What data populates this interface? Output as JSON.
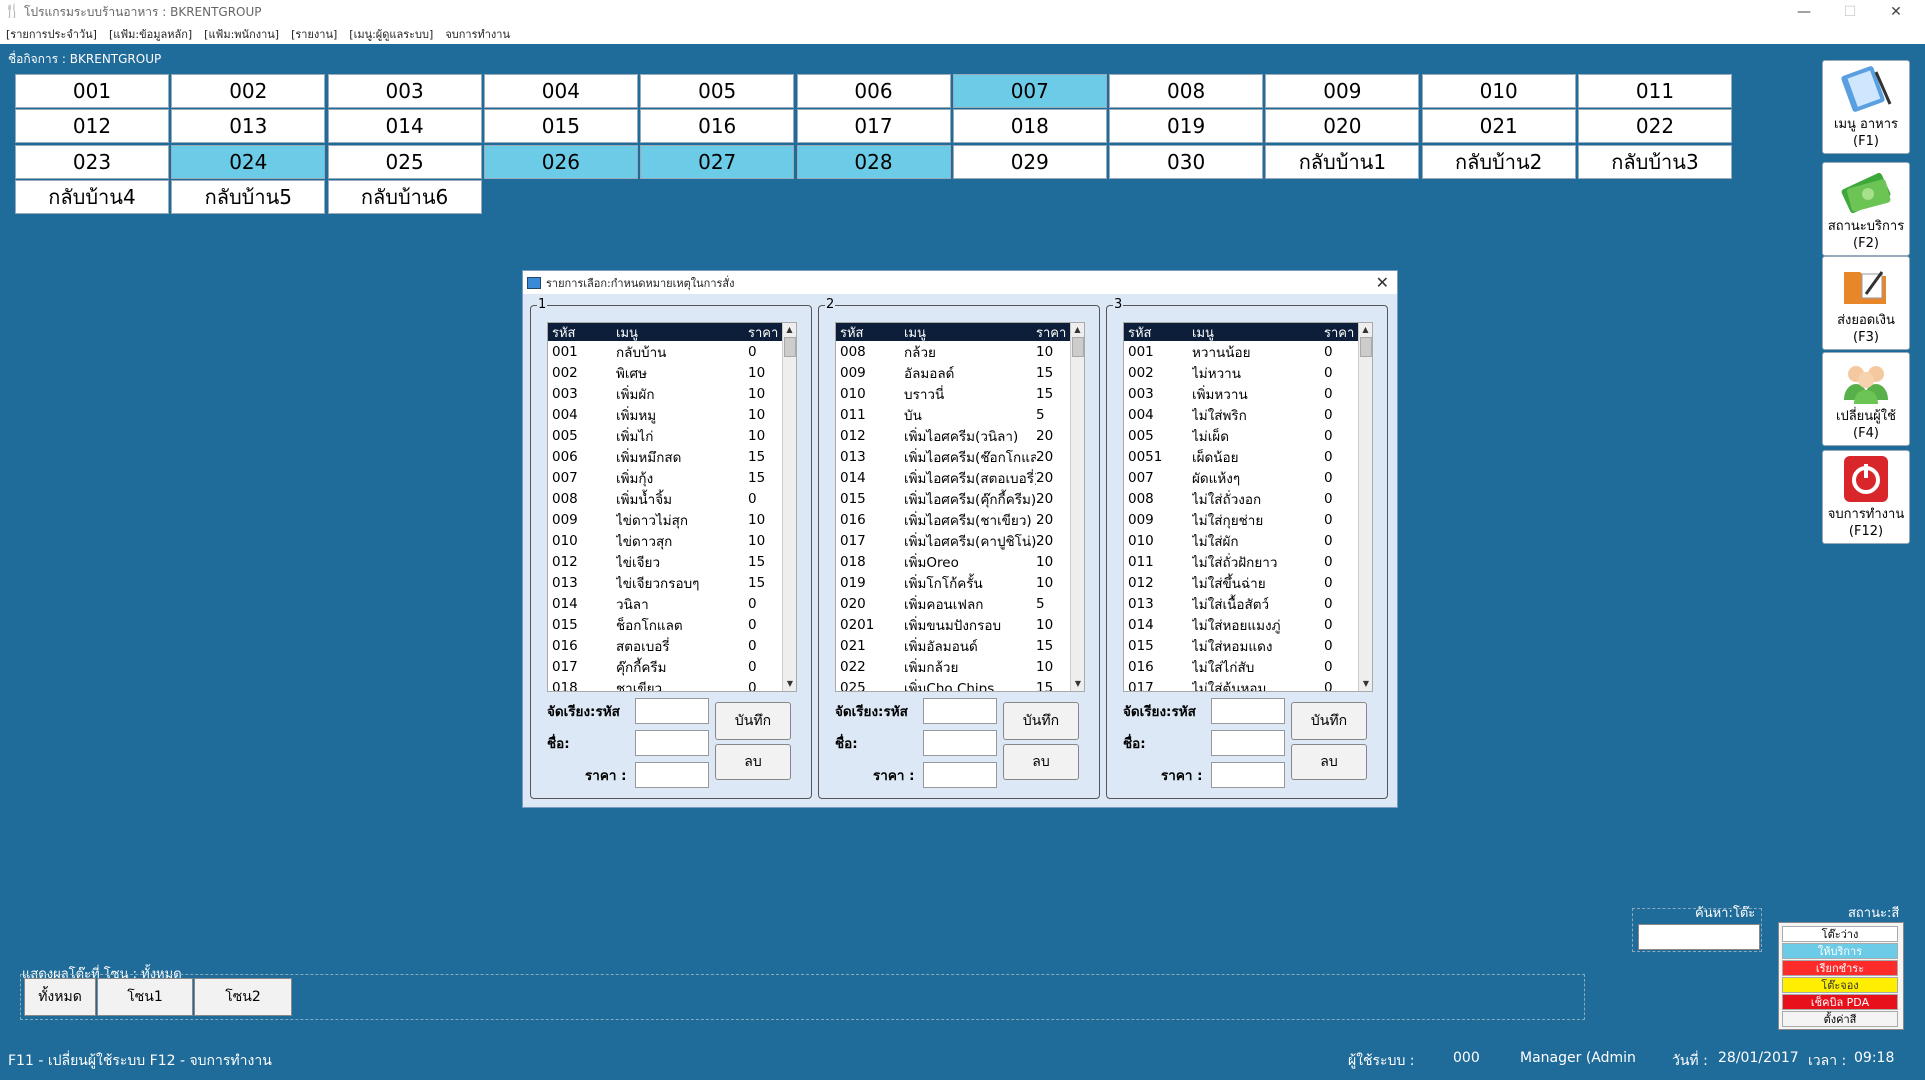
{
  "window": {
    "title": "โปรแกรมระบบร้านอาหาร : BKRENTGROUP"
  },
  "menu": [
    "[รายการประจำวัน]",
    "[แฟ้ม:ข้อมูลหลัก]",
    "[แฟ้ม:พนักงาน]",
    "[รายงาน]",
    "[เมนู:ผู้ดูแลระบบ]",
    "จบการทำงาน"
  ],
  "business": {
    "label": "ชื่อกิจการ :",
    "name": "BKRENTGROUP"
  },
  "tables": [
    {
      "label": "001",
      "occupied": false
    },
    {
      "label": "002",
      "occupied": false
    },
    {
      "label": "003",
      "occupied": false
    },
    {
      "label": "004",
      "occupied": false
    },
    {
      "label": "005",
      "occupied": false
    },
    {
      "label": "006",
      "occupied": false
    },
    {
      "label": "007",
      "occupied": true
    },
    {
      "label": "008",
      "occupied": false
    },
    {
      "label": "009",
      "occupied": false
    },
    {
      "label": "010",
      "occupied": false
    },
    {
      "label": "011",
      "occupied": false
    },
    {
      "label": "012",
      "occupied": false
    },
    {
      "label": "013",
      "occupied": false
    },
    {
      "label": "014",
      "occupied": false
    },
    {
      "label": "015",
      "occupied": false
    },
    {
      "label": "016",
      "occupied": false
    },
    {
      "label": "017",
      "occupied": false
    },
    {
      "label": "018",
      "occupied": false
    },
    {
      "label": "019",
      "occupied": false
    },
    {
      "label": "020",
      "occupied": false
    },
    {
      "label": "021",
      "occupied": false
    },
    {
      "label": "022",
      "occupied": false
    },
    {
      "label": "023",
      "occupied": false
    },
    {
      "label": "024",
      "occupied": true
    },
    {
      "label": "025",
      "occupied": false
    },
    {
      "label": "026",
      "occupied": true
    },
    {
      "label": "027",
      "occupied": true
    },
    {
      "label": "028",
      "occupied": true
    },
    {
      "label": "029",
      "occupied": false
    },
    {
      "label": "030",
      "occupied": false
    },
    {
      "label": "กลับบ้าน1",
      "occupied": false
    },
    {
      "label": "กลับบ้าน2",
      "occupied": false
    },
    {
      "label": "กลับบ้าน3",
      "occupied": false
    },
    {
      "label": "กลับบ้าน4",
      "occupied": false
    },
    {
      "label": "กลับบ้าน5",
      "occupied": false
    },
    {
      "label": "กลับบ้าน6",
      "occupied": false
    }
  ],
  "side_buttons": [
    {
      "line1": "เมนู อาหาร",
      "line2": "(F1)",
      "icon": "food-menu-icon"
    },
    {
      "line1": "สถานะบริการ",
      "line2": "(F2)",
      "icon": "money-icon"
    },
    {
      "line1": "ส่งยอดเงิน",
      "line2": "(F3)",
      "icon": "folder-edit-icon"
    },
    {
      "line1": "เปลี่ยนผู้ใช้",
      "line2": "(F4)",
      "icon": "users-icon"
    },
    {
      "line1": "จบการทำงาน",
      "line2": "(F12)",
      "icon": "power-icon"
    }
  ],
  "dialog": {
    "title": "รายการเลือก:กำหนดหมายเหตุในการสั่ง",
    "columns": {
      "code": "รหัส",
      "menu": "เมนู",
      "price": "ราคา"
    },
    "form": {
      "sort_label": "จัดเรียง:รหัส",
      "name_label": "ชื่อ:",
      "price_label": "ราคา :",
      "save": "บันทึก",
      "delete": "ลบ"
    },
    "groups": [
      {
        "num": "1",
        "rows": [
          [
            "001",
            "กลับบ้าน",
            "0"
          ],
          [
            "002",
            "พิเศษ",
            "10"
          ],
          [
            "003",
            "เพิ่มผัก",
            "10"
          ],
          [
            "004",
            "เพิ่มหมู",
            "10"
          ],
          [
            "005",
            "เพิ่มไก่",
            "10"
          ],
          [
            "006",
            "เพิ่มหมึกสด",
            "15"
          ],
          [
            "007",
            "เพิ่มกุ้ง",
            "15"
          ],
          [
            "008",
            "เพิ่มน้ำจิ้ม",
            "0"
          ],
          [
            "009",
            "ไข่ดาวไม่สุก",
            "10"
          ],
          [
            "010",
            "ไข่ดาวสุก",
            "10"
          ],
          [
            "012",
            "ไข่เจียว",
            "15"
          ],
          [
            "013",
            "ไข่เจียวกรอบๆ",
            "15"
          ],
          [
            "014",
            "วนิลา",
            "0"
          ],
          [
            "015",
            "ช็อกโกแลต",
            "0"
          ],
          [
            "016",
            "สตอเบอรี่",
            "0"
          ],
          [
            "017",
            "คุ๊กกี้ครีม",
            "0"
          ],
          [
            "018",
            "ชาเขียว",
            "0"
          ]
        ]
      },
      {
        "num": "2",
        "rows": [
          [
            "008",
            "กล้วย",
            "10"
          ],
          [
            "009",
            "อัลมอลด์",
            "15"
          ],
          [
            "010",
            "บราวนี่",
            "15"
          ],
          [
            "011",
            "บัน",
            "5"
          ],
          [
            "012",
            "เพิ่มไอศครีม(วนิลา)",
            "20"
          ],
          [
            "013",
            "เพิ่มไอศครีม(ช๊อกโกแลต)",
            "20"
          ],
          [
            "014",
            "เพิ่มไอศครีม(สตอเบอรี่)",
            "20"
          ],
          [
            "015",
            "เพิ่มไอศครีม(คุ๊กกี้ครีม)",
            "20"
          ],
          [
            "016",
            "เพิ่มไอศครีม(ชาเขียว)",
            "20"
          ],
          [
            "017",
            "เพิ่มไอศครีม(คาปูชิโน่)",
            "20"
          ],
          [
            "018",
            "เพิ่มOreo",
            "10"
          ],
          [
            "019",
            "เพิ่มโกโก้ครั้น",
            "10"
          ],
          [
            "020",
            "เพิ่มคอนเฟลก",
            "5"
          ],
          [
            "0201",
            "เพิ่มขนมปังกรอบ",
            "10"
          ],
          [
            "021",
            "เพิ่มอัลมอนด์",
            "15"
          ],
          [
            "022",
            "เพิ่มกล้วย",
            "10"
          ],
          [
            "025",
            "เพิ่มCho Chips",
            "15"
          ]
        ]
      },
      {
        "num": "3",
        "rows": [
          [
            "001",
            "หวานน้อย",
            "0"
          ],
          [
            "002",
            "ไม่หวาน",
            "0"
          ],
          [
            "003",
            "เพิ่มหวาน",
            "0"
          ],
          [
            "004",
            "ไม่ใส่พริก",
            "0"
          ],
          [
            "005",
            "ไม่เผ็ด",
            "0"
          ],
          [
            "0051",
            "เผ็ดน้อย",
            "0"
          ],
          [
            "007",
            "ผัดแห้งๆ",
            "0"
          ],
          [
            "008",
            "ไม่ใส่ถั่วงอก",
            "0"
          ],
          [
            "009",
            "ไม่ใส่กุยช่าย",
            "0"
          ],
          [
            "010",
            "ไม่ใส่ผัก",
            "0"
          ],
          [
            "011",
            "ไม่ใส่ถั่วฝักยาว",
            "0"
          ],
          [
            "012",
            "ไม่ใส่ขึ้นฉ่าย",
            "0"
          ],
          [
            "013",
            "ไม่ใส่เนื้อสัตว์",
            "0"
          ],
          [
            "014",
            "ไม่ใส่หอยแมงภู่",
            "0"
          ],
          [
            "015",
            "ไม่ใส่หอมแดง",
            "0"
          ],
          [
            "016",
            "ไม่ใส่ไก่สับ",
            "0"
          ],
          [
            "017",
            "ไม่ใส่ต้นหอม",
            "0"
          ]
        ]
      }
    ]
  },
  "zone": {
    "label": "แสดงผลโต๊ะที่  โซน : ทั้งหมด",
    "buttons": [
      "ทั้งหมด",
      "โซน1",
      "โซน2"
    ]
  },
  "search": {
    "label": "ค้นหา:โต๊ะ"
  },
  "status_panel": {
    "label": "สถานะ:สี",
    "legend": [
      {
        "text": "โต๊ะว่าง",
        "bg": "#ffffff",
        "fg": "#000000"
      },
      {
        "text": "ให้บริการ",
        "bg": "#6ccbe6",
        "fg": "#ffffff"
      },
      {
        "text": "เรียกชำระ",
        "bg": "#ff2a2a",
        "fg": "#ffffff"
      },
      {
        "text": "โต๊ะจอง",
        "bg": "#ffee00",
        "fg": "#333333"
      },
      {
        "text": "เช็คบิล PDA",
        "bg": "#e8101a",
        "fg": "#ffffff"
      },
      {
        "text": "ตั้งค่าสี",
        "bg": "#f4f4f4",
        "fg": "#000000"
      }
    ]
  },
  "statusbar": {
    "hotkeys": "F11 - เปลี่ยนผู้ใช้ระบบ   F12 - จบการทำงาน",
    "user_label": "ผู้ใช้ระบบ :",
    "user_code": "000",
    "user_name": "Manager (Admin",
    "date_label": "วันที่ :",
    "date": "28/01/2017",
    "time_label": "เวลา :",
    "time": "09:18"
  }
}
